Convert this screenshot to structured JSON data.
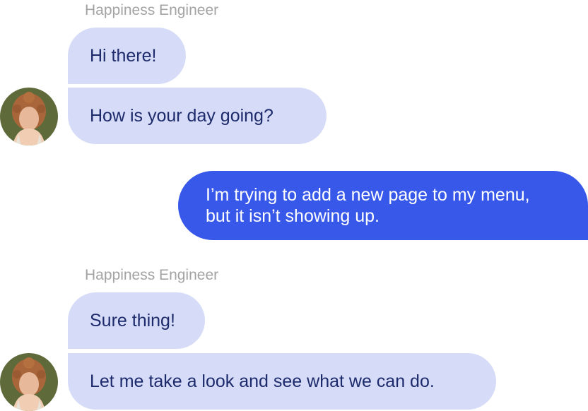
{
  "conversation": {
    "group1": {
      "sender": "Happiness Engineer",
      "messages": [
        "Hi there!",
        "How is your day going?"
      ]
    },
    "user_message": {
      "lines": [
        "I’m trying to add a new page to my menu,",
        "but it isn’t showing up."
      ]
    },
    "group2": {
      "sender": "Happiness Engineer",
      "messages": [
        "Sure thing!",
        "Let me take a look and see what we can do."
      ]
    }
  },
  "colors": {
    "incoming_bubble": "#d6dcf7",
    "incoming_text": "#1d2a6b",
    "outgoing_bubble": "#3858e9",
    "outgoing_text": "#ffffff",
    "sender_label": "#a3a3a3"
  },
  "icons": {
    "avatar": "support-agent-avatar"
  }
}
